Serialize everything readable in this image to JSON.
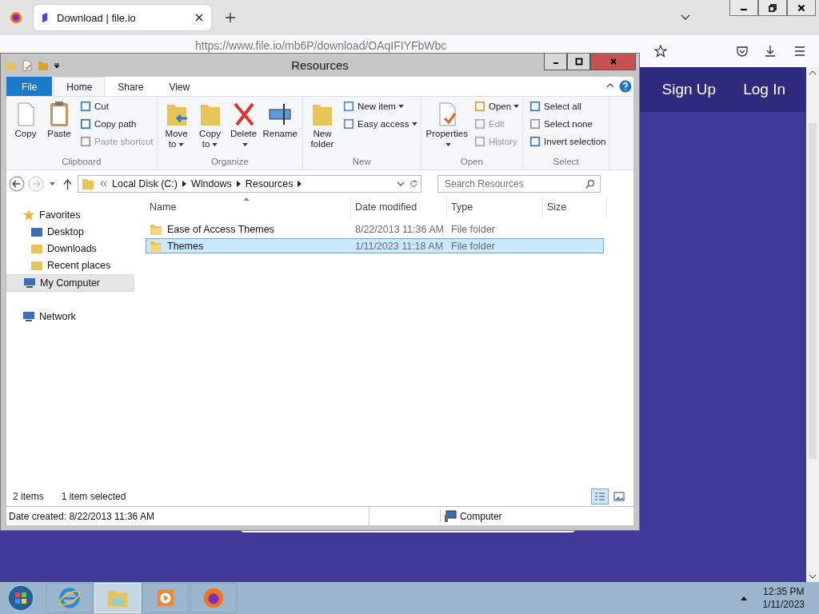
{
  "browser": {
    "tab_title": "Download | file.io",
    "url": "https://www.file.io/mb6P/download/OAqIFIYFbWbc",
    "nav_links": [
      "Sign Up",
      "Log In"
    ]
  },
  "explorer": {
    "title": "Resources",
    "ribbon_tabs": [
      {
        "label": "File",
        "kind": "file",
        "selected": false
      },
      {
        "label": "Home",
        "kind": "tab",
        "selected": true
      },
      {
        "label": "Share",
        "kind": "tab",
        "selected": false
      },
      {
        "label": "View",
        "kind": "tab",
        "selected": false
      }
    ],
    "groups": [
      {
        "label": "Clipboard",
        "items": [
          {
            "label": "Copy",
            "kind": "large",
            "disabled": false,
            "dropdown": false
          },
          {
            "label": "Paste",
            "kind": "large",
            "disabled": false,
            "dropdown": false
          },
          {
            "label": "Cut",
            "kind": "small",
            "disabled": false,
            "dropdown": false
          },
          {
            "label": "Copy path",
            "kind": "small",
            "disabled": false,
            "dropdown": false
          },
          {
            "label": "Paste shortcut",
            "kind": "small",
            "disabled": true,
            "dropdown": false
          }
        ]
      },
      {
        "label": "Organize",
        "items": [
          {
            "label": "Move to",
            "kind": "large",
            "disabled": false,
            "dropdown": true
          },
          {
            "label": "Copy to",
            "kind": "large",
            "disabled": false,
            "dropdown": true
          },
          {
            "label": "Delete",
            "kind": "large",
            "disabled": false,
            "dropdown": true
          },
          {
            "label": "Rename",
            "kind": "large",
            "disabled": false,
            "dropdown": false
          }
        ]
      },
      {
        "label": "New",
        "items": [
          {
            "label": "New folder",
            "kind": "large",
            "disabled": false,
            "dropdown": false
          },
          {
            "label": "New item",
            "kind": "small",
            "disabled": false,
            "dropdown": true
          },
          {
            "label": "Easy access",
            "kind": "small",
            "disabled": false,
            "dropdown": true
          }
        ]
      },
      {
        "label": "Open",
        "items": [
          {
            "label": "Properties",
            "kind": "large",
            "disabled": false,
            "dropdown": true
          },
          {
            "label": "Open",
            "kind": "small",
            "disabled": false,
            "dropdown": true
          },
          {
            "label": "Edit",
            "kind": "small",
            "disabled": true,
            "dropdown": false
          },
          {
            "label": "History",
            "kind": "small",
            "disabled": true,
            "dropdown": false
          }
        ]
      },
      {
        "label": "Select",
        "items": [
          {
            "label": "Select all",
            "kind": "small",
            "disabled": false,
            "dropdown": false
          },
          {
            "label": "Select none",
            "kind": "small",
            "disabled": false,
            "dropdown": false
          },
          {
            "label": "Invert selection",
            "kind": "small",
            "disabled": false,
            "dropdown": false
          }
        ]
      }
    ],
    "breadcrumbs": [
      "Local Disk (C:)",
      "Windows",
      "Resources"
    ],
    "search": {
      "placeholder": "Search Resources"
    },
    "nav_tree": [
      {
        "label": "Favorites",
        "selected": false,
        "children": [
          {
            "label": "Desktop",
            "selected": false
          },
          {
            "label": "Downloads",
            "selected": false
          },
          {
            "label": "Recent places",
            "selected": false
          }
        ]
      },
      {
        "label": "My Computer",
        "selected": true
      },
      {
        "label": "Network",
        "selected": false
      }
    ],
    "columns": [
      "Name",
      "Date modified",
      "Type",
      "Size"
    ],
    "rows": [
      {
        "name": "Ease of Access Themes",
        "date_modified": "8/22/2013 11:36 AM",
        "type": "File folder",
        "selected": false
      },
      {
        "name": "Themes",
        "date_modified": "1/11/2023 11:18 AM",
        "type": "File folder",
        "selected": true
      }
    ],
    "status": {
      "item_count": "2 items",
      "selection": "1 item selected"
    },
    "views": [
      {
        "selected": true
      },
      {
        "selected": false
      }
    ],
    "details": {
      "text": "Date created: 8/22/2013 11:36 AM",
      "location": "Computer"
    }
  },
  "taskbar": {
    "apps": [
      {
        "selected": false
      },
      {
        "selected": true
      },
      {
        "selected": false
      },
      {
        "selected": false
      }
    ],
    "time": "12:35 PM",
    "date": "1/11/2023"
  }
}
